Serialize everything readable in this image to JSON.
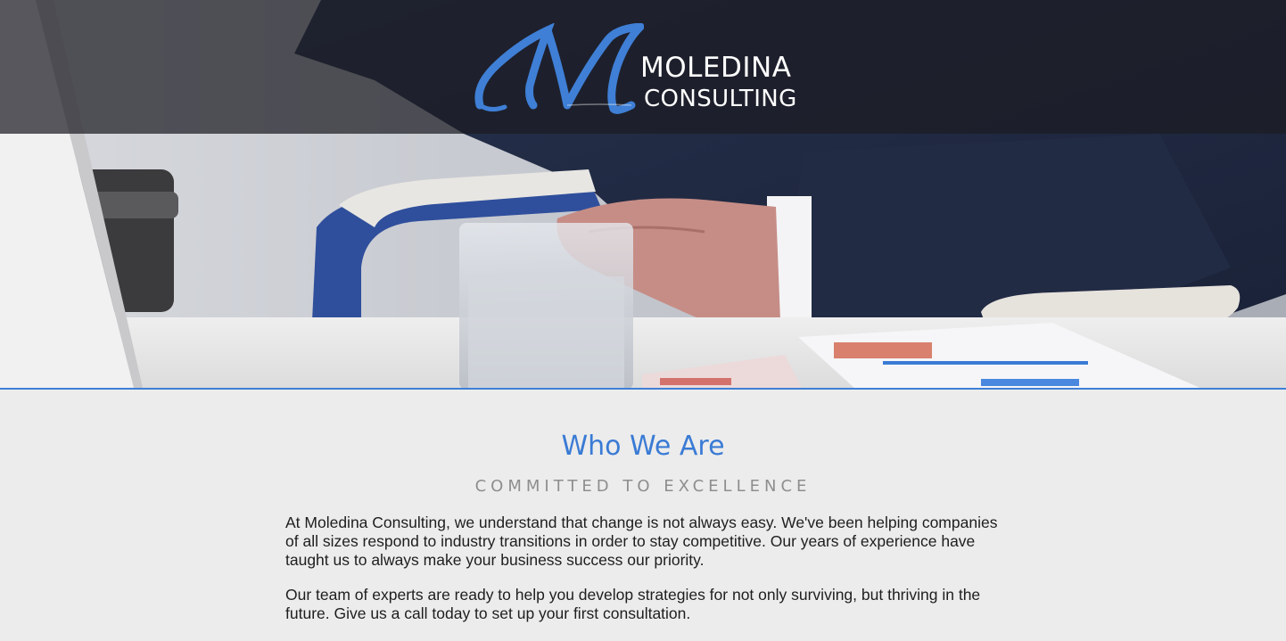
{
  "header": {
    "logo": {
      "monogram": "M",
      "line1": "MOLEDINA",
      "line2": "CONSULTING"
    }
  },
  "hero": {
    "image_icon": "businessman-at-desk-photo"
  },
  "about": {
    "title": "Who We Are",
    "subtitle": "COMMITTED TO EXCELLENCE",
    "paragraphs": [
      "At Moledina Consulting, we understand that change is not always easy. We've been helping companies of all sizes respond to industry transitions in order to stay competitive. Our years of experience have taught us to always make your business success our priority.",
      "Our team of experts are ready to help you develop strategies for not only surviving, but thriving in the future. Give us a call today to set up your first consultation."
    ]
  },
  "colors": {
    "accent": "#3a7bd5",
    "header_band": "#1c1c22",
    "background": "#ececec",
    "subtitle": "#8e8e8e",
    "text": "#1e1e1e"
  }
}
